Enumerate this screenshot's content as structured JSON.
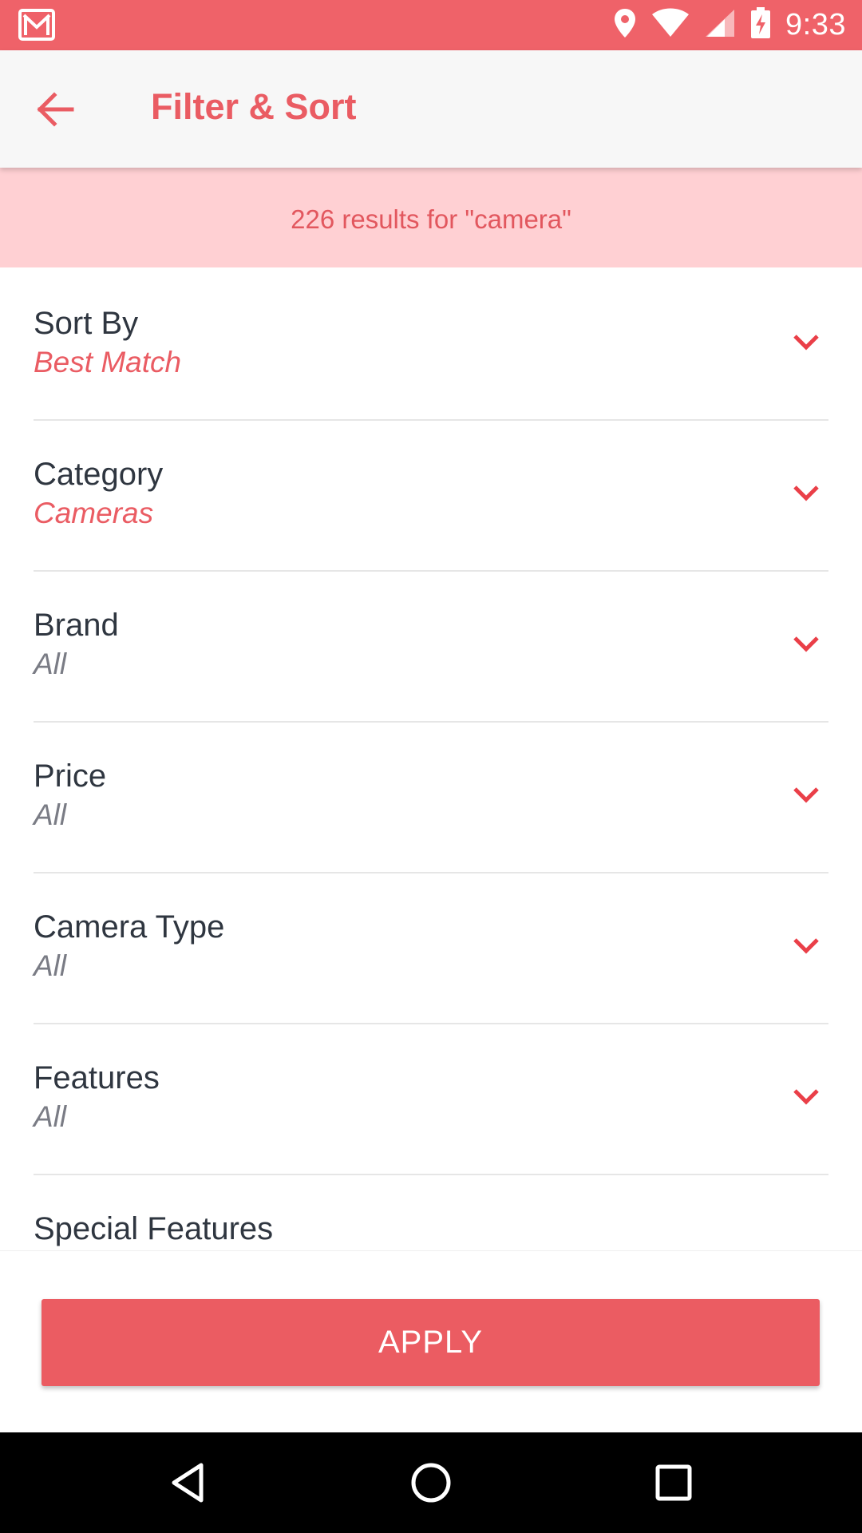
{
  "status_bar": {
    "time": "9:33",
    "icons": [
      "gmail-icon",
      "location-icon",
      "wifi-icon",
      "signal-icon",
      "battery-charging-icon"
    ]
  },
  "toolbar": {
    "back_icon": "arrow-left-icon",
    "title": "Filter & Sort"
  },
  "results": {
    "text": "226 results for \"camera\""
  },
  "filters": [
    {
      "label": "Sort By",
      "value": "Best Match",
      "selected": true
    },
    {
      "label": "Category",
      "value": "Cameras",
      "selected": true
    },
    {
      "label": "Brand",
      "value": "All",
      "selected": false
    },
    {
      "label": "Price",
      "value": "All",
      "selected": false
    },
    {
      "label": "Camera Type",
      "value": "All",
      "selected": false
    },
    {
      "label": "Features",
      "value": "All",
      "selected": false
    },
    {
      "label": "Special Features",
      "value": "",
      "selected": false
    }
  ],
  "apply": {
    "label": "APPLY"
  },
  "nav_bar": {
    "icons": [
      "nav-back-icon",
      "nav-home-icon",
      "nav-recents-icon"
    ]
  },
  "colors": {
    "accent": "#ea5c63",
    "status_bar": "#ef6269",
    "banner": "#ffd0d3",
    "toolbar": "#f7f7f7"
  }
}
